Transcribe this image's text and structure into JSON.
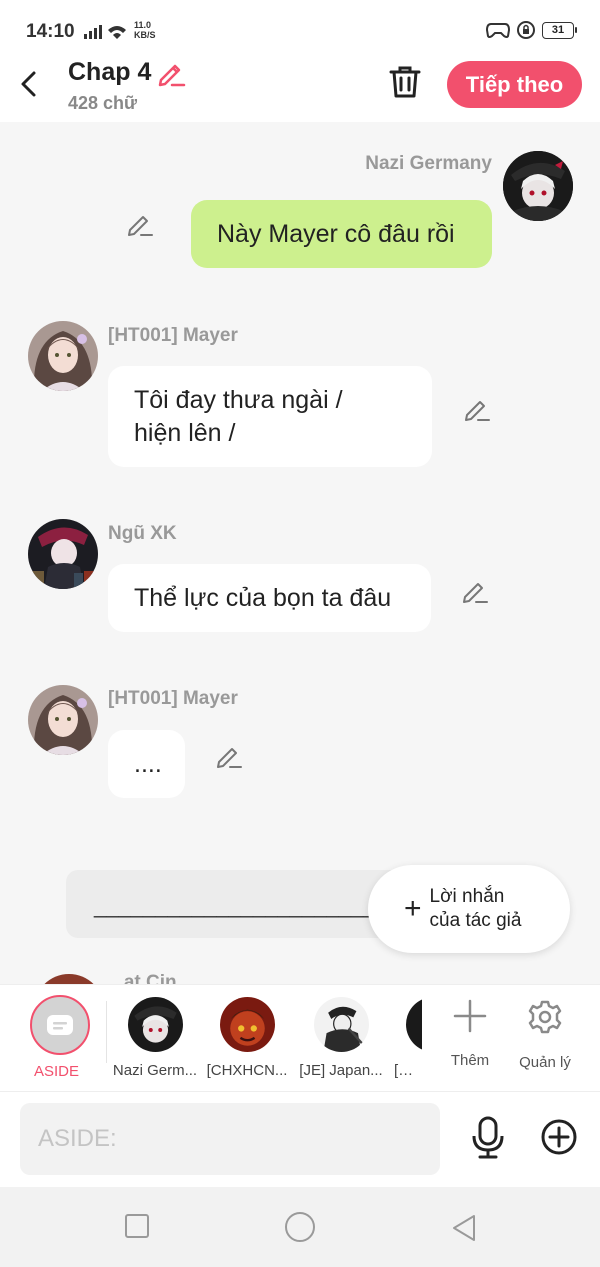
{
  "status": {
    "time": "14:10",
    "net_speed": "11.0",
    "net_unit": "KB/S",
    "battery": "31"
  },
  "header": {
    "title": "Chap 4",
    "word_count": "428 chữ",
    "next_label": "Tiếp theo"
  },
  "messages": [
    {
      "sender": "Nazi Germany",
      "text": "Này Mayer cô đâu rồi"
    },
    {
      "sender": "[HT001] Mayer",
      "text_line1": "Tôi đay thưa ngài /",
      "text_line2": "hiện lên /"
    },
    {
      "sender": "Ngũ XK",
      "text": "Thể lực của bọn ta đâu"
    },
    {
      "sender": "[HT001] Mayer",
      "text": "...."
    }
  ],
  "comment_line": "________________________",
  "author_note": {
    "line1": "Lời nhắn",
    "line2": "của tác giả"
  },
  "peek_text": "...at Cin...",
  "charbar": {
    "aside_label": "ASIDE",
    "characters": [
      {
        "name": "Nazi Germ..."
      },
      {
        "name": "[CHXHCN..."
      },
      {
        "name": "[JE] Japan..."
      },
      {
        "name": "[USA..."
      }
    ],
    "add_label": "Thêm",
    "manage_label": "Quản lý"
  },
  "input": {
    "placeholder": "ASIDE:"
  },
  "colors": {
    "accent": "#f2506d",
    "my_bubble": "#cdf08e",
    "background": "#f6f6f6"
  }
}
